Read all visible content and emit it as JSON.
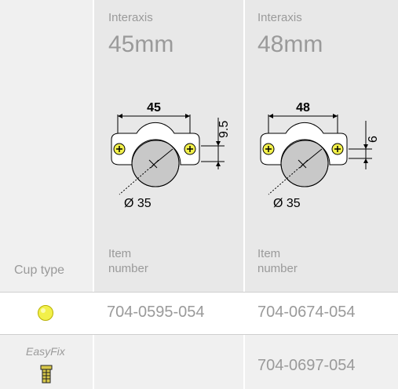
{
  "columns": [
    {
      "header_label": "Interaxis",
      "header_value": "45mm",
      "diagram": {
        "spacing_label": "45",
        "offset_label": "9.5",
        "diameter_label": "Ø 35"
      },
      "item_label": "Item\nnumber"
    },
    {
      "header_label": "Interaxis",
      "header_value": "48mm",
      "diagram": {
        "spacing_label": "48",
        "offset_label": "6",
        "diameter_label": "Ø 35"
      },
      "item_label": "Item\nnumber"
    }
  ],
  "cup_type_label": "Cup type",
  "rows": [
    {
      "type_icon": "yellow-circle-icon",
      "type_label": "",
      "items": [
        "704-0595-054",
        "704-0674-054"
      ]
    },
    {
      "type_icon": "screw-icon",
      "type_label": "EasyFix",
      "items": [
        "",
        "704-0697-054"
      ]
    }
  ],
  "colors": {
    "header_bg": "#e8e8e8",
    "row_bg": "#f0f0f0",
    "text": "#9a9a9a",
    "cup_yellow": "#f2f04a",
    "screw_yellow": "#d8c84a"
  }
}
